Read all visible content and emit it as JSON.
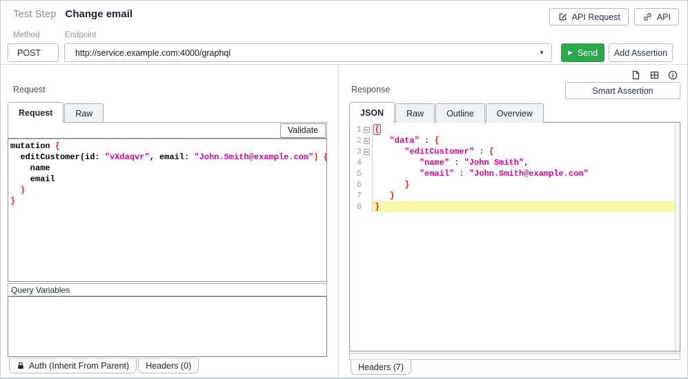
{
  "header": {
    "kicker": "Test Step",
    "title": "Change email",
    "api_request_button": "API Request",
    "api_button": "API",
    "method_label": "Method",
    "endpoint_label": "Endpoint",
    "method_value": "POST",
    "endpoint_value": "http://service.example.com:4000/graphql",
    "send_button": "Send",
    "add_assertion_button": "Add Assertion"
  },
  "icons": {
    "caret_down": "▼",
    "play": "▶"
  },
  "request_panel": {
    "title": "Request",
    "tabs": [
      "Request",
      "Raw"
    ],
    "active_tab": "Request",
    "validate_button": "Validate",
    "editor": {
      "lines": [
        [
          [
            "mutation ",
            "t"
          ],
          [
            "{",
            "p"
          ]
        ],
        [
          [
            "  editCustomer(id: ",
            "t"
          ],
          [
            "\"vXdaqvr\"",
            "s"
          ],
          [
            ", email: ",
            "t"
          ],
          [
            "\"John.Smith@example.com\"",
            "s"
          ],
          [
            ") {",
            "p"
          ]
        ],
        [
          [
            "    name",
            "t"
          ]
        ],
        [
          [
            "    email",
            "t"
          ]
        ],
        [
          [
            "  }",
            "p"
          ]
        ],
        [
          [
            "}",
            "p"
          ]
        ]
      ]
    },
    "query_variables_label": "Query Variables",
    "query_variables_value": "",
    "auth_tab": "Auth (Inherit From Parent)",
    "headers_tab": "Headers (0)"
  },
  "response_panel": {
    "title": "Response",
    "smart_assertion_button": "Smart Assertion",
    "tabs": [
      "JSON",
      "Raw",
      "Outline",
      "Overview"
    ],
    "active_tab": "JSON",
    "editor": {
      "lines": [
        {
          "num": "1",
          "fold": true,
          "hl": false,
          "segs": [
            [
              "{",
              "psel"
            ]
          ]
        },
        {
          "num": "2",
          "fold": true,
          "hl": false,
          "segs": [
            [
              "   ",
              "t"
            ],
            [
              "\"data\"",
              "s"
            ],
            [
              " : ",
              "g"
            ],
            [
              "{",
              "p"
            ]
          ]
        },
        {
          "num": "3",
          "fold": true,
          "hl": false,
          "segs": [
            [
              "      ",
              "t"
            ],
            [
              "\"editCustomer\"",
              "s"
            ],
            [
              " : ",
              "g"
            ],
            [
              "{",
              "p"
            ]
          ]
        },
        {
          "num": "4",
          "fold": false,
          "hl": false,
          "segs": [
            [
              "         ",
              "t"
            ],
            [
              "\"name\"",
              "s"
            ],
            [
              " : ",
              "g"
            ],
            [
              "\"John Smith\"",
              "s"
            ],
            [
              ",",
              "g"
            ]
          ]
        },
        {
          "num": "5",
          "fold": false,
          "hl": false,
          "segs": [
            [
              "         ",
              "t"
            ],
            [
              "\"email\"",
              "s"
            ],
            [
              " : ",
              "g"
            ],
            [
              "\"John.Smith@example.com\"",
              "s"
            ]
          ]
        },
        {
          "num": "6",
          "fold": false,
          "hl": false,
          "segs": [
            [
              "      ",
              "t"
            ],
            [
              "}",
              "p"
            ]
          ]
        },
        {
          "num": "7",
          "fold": false,
          "hl": false,
          "segs": [
            [
              "   ",
              "t"
            ],
            [
              "}",
              "p"
            ]
          ]
        },
        {
          "num": "8",
          "fold": false,
          "hl": true,
          "segs": [
            [
              "}",
              "p"
            ]
          ]
        }
      ]
    },
    "headers_tab": "Headers (7)"
  },
  "colors": {
    "send_green": "#2ba84a",
    "string_magenta": "#d6009a",
    "brace_red": "#dd2222",
    "line_highlight_yellow": "#f9f9ae",
    "selection_outline_blue": "#3a57c4"
  }
}
